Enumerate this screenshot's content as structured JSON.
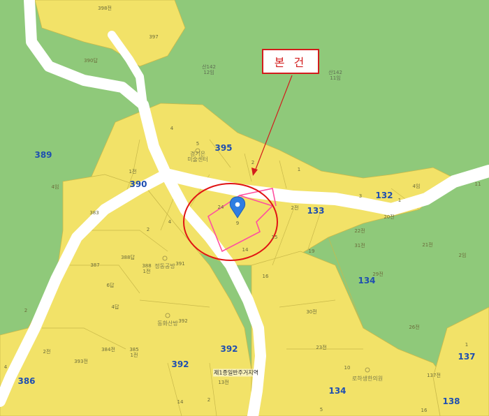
{
  "map": {
    "colors": {
      "forest": "#8fc97a",
      "parcel": "#f2e268",
      "road": "#ffffff",
      "block_label": "#1f4fb0",
      "highlight": "#ff4fa0",
      "circle": "#e01414",
      "marker": "#2f7de1"
    },
    "callout": {
      "text": "본 건"
    },
    "block_numbers": [
      "398전",
      "389",
      "390",
      "395",
      "132",
      "133",
      "134",
      "137",
      "138",
      "386",
      "392",
      "392",
      "134"
    ],
    "blocks": [
      {
        "name": "block-389",
        "text": "389"
      },
      {
        "name": "block-390",
        "text": "390"
      },
      {
        "name": "block-395",
        "text": "395"
      },
      {
        "name": "block-132",
        "text": "132"
      },
      {
        "name": "block-133",
        "text": "133"
      },
      {
        "name": "block-134-east",
        "text": "134"
      },
      {
        "name": "block-137",
        "text": "137"
      },
      {
        "name": "block-138",
        "text": "138"
      },
      {
        "name": "block-386",
        "text": "386"
      },
      {
        "name": "block-392-center",
        "text": "392"
      },
      {
        "name": "block-392-south",
        "text": "392"
      },
      {
        "name": "block-134-south",
        "text": "134"
      }
    ],
    "lots": [
      {
        "name": "lot-398-jeon",
        "text": "398전"
      },
      {
        "name": "lot-397",
        "text": "397"
      },
      {
        "name": "lot-390-dap",
        "text": "390답"
      },
      {
        "name": "lot-4-top",
        "text": "4"
      },
      {
        "name": "lot-5",
        "text": "5"
      },
      {
        "name": "lot-2-north",
        "text": "2"
      },
      {
        "name": "lot-1-north",
        "text": "1"
      },
      {
        "name": "lot-1-jeon",
        "text": "1전"
      },
      {
        "name": "lot-4-im",
        "text": "4임"
      },
      {
        "name": "lot-383",
        "text": "383"
      },
      {
        "name": "lot-2-west",
        "text": "2"
      },
      {
        "name": "lot-4-west",
        "text": "4"
      },
      {
        "name": "lot-24",
        "text": "24"
      },
      {
        "name": "lot-9-subject",
        "text": "9"
      },
      {
        "name": "lot-14",
        "text": "14"
      },
      {
        "name": "lot-15",
        "text": "15"
      },
      {
        "name": "lot-16",
        "text": "16"
      },
      {
        "name": "lot-2-jeon",
        "text": "2전"
      },
      {
        "name": "lot-3",
        "text": "3"
      },
      {
        "name": "lot-1-east",
        "text": "1"
      },
      {
        "name": "lot-4-im-east",
        "text": "4임"
      },
      {
        "name": "lot-11",
        "text": "11"
      },
      {
        "name": "lot-20-jeon",
        "text": "20전"
      },
      {
        "name": "lot-22-jeon",
        "text": "22전"
      },
      {
        "name": "lot-31-jeon",
        "text": "31전"
      },
      {
        "name": "lot-19",
        "text": "19"
      },
      {
        "name": "lot-29-jeon",
        "text": "29전"
      },
      {
        "name": "lot-21-jeon",
        "text": "21전"
      },
      {
        "name": "lot-2-im",
        "text": "2임"
      },
      {
        "name": "lot-26-jeon",
        "text": "26전"
      },
      {
        "name": "lot-30-jeon",
        "text": "30전"
      },
      {
        "name": "lot-23-jeon",
        "text": "23전"
      },
      {
        "name": "lot-10",
        "text": "10"
      },
      {
        "name": "lot-137-jeon",
        "text": "137전"
      },
      {
        "name": "lot-1-se",
        "text": "1"
      },
      {
        "name": "lot-5-south",
        "text": "5"
      },
      {
        "name": "lot-16-south",
        "text": "16"
      },
      {
        "name": "lot-387",
        "text": "387"
      },
      {
        "name": "lot-388-dap",
        "text": "388답"
      },
      {
        "name": "lot-388-1-jeon",
        "text": "388\n1전"
      },
      {
        "name": "lot-391",
        "text": "391"
      },
      {
        "name": "lot-6-dap",
        "text": "6답"
      },
      {
        "name": "lot-4-dap",
        "text": "4답"
      },
      {
        "name": "lot-392-small",
        "text": "392"
      },
      {
        "name": "lot-2-far-west",
        "text": "2"
      },
      {
        "name": "lot-2-jeon-sw",
        "text": "2전"
      },
      {
        "name": "lot-384-jeon",
        "text": "384전"
      },
      {
        "name": "lot-385-1-jeon",
        "text": "385\n1전"
      },
      {
        "name": "lot-393-jeon",
        "text": "393전"
      },
      {
        "name": "lot-4-sw",
        "text": "4"
      },
      {
        "name": "lot-13-jeon",
        "text": "13전"
      },
      {
        "name": "lot-14-south",
        "text": "14"
      },
      {
        "name": "lot-2-south",
        "text": "2"
      }
    ],
    "buildings": [
      {
        "name": "building-misul",
        "text": "경기은\n미술센터"
      },
      {
        "name": "building-gongbang",
        "text": "정동공방"
      },
      {
        "name": "building-dongwha",
        "text": "동화산방"
      },
      {
        "name": "building-clinic",
        "text": "로하생한의원"
      }
    ],
    "mountain_labels": [
      {
        "name": "mountain-142-west",
        "text": "산142\n12임"
      },
      {
        "name": "mountain-142-east",
        "text": "산142\n11임"
      }
    ],
    "zone_label": {
      "text": "제1종일반주거지역"
    }
  }
}
